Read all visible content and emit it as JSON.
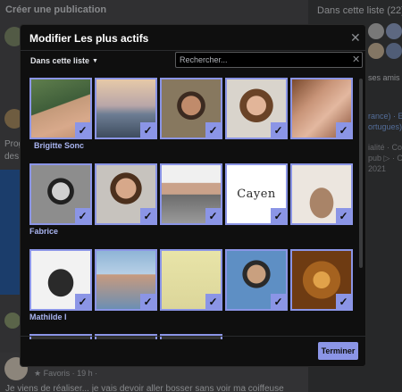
{
  "background": {
    "create_post_label": "Créer une publication",
    "list_header": "Dans cette liste (22)",
    "snippet_friends": "ses amis à c",
    "snippet_lang_1": "rance) · En",
    "snippet_lang_2": "ortugues) E",
    "snippet_policies": "ialité · Cond",
    "snippet_ads": "pub ▷ · Cookie",
    "snippet_year": "2021",
    "snippet_post_1": "Prog",
    "snippet_post_2": "des",
    "favorites_meta": "★ Favoris · 19 h ·",
    "post_text": "Je viens de réaliser... je vais devoir aller bosser sans voir ma coiffeuse"
  },
  "modal": {
    "title": "Modifier Les plus actifs",
    "close_icon": "close-icon",
    "filter_label": "Dans cette liste",
    "search_placeholder": "Rechercher...",
    "done_label": "Terminer",
    "accent_color": "#8b95e6",
    "tiles": [
      {
        "name": "Brigitte Sonc",
        "selected": true
      },
      {
        "name": "",
        "selected": true
      },
      {
        "name": "",
        "selected": true
      },
      {
        "name": "",
        "selected": true
      },
      {
        "name": "",
        "selected": true
      },
      {
        "name": "Fabrice",
        "selected": true
      },
      {
        "name": "",
        "selected": true
      },
      {
        "name": "",
        "selected": true
      },
      {
        "name": "Cayen",
        "selected": true
      },
      {
        "name": "",
        "selected": true
      },
      {
        "name": "Mathilde I",
        "selected": true
      },
      {
        "name": "",
        "selected": true
      },
      {
        "name": "",
        "selected": true
      },
      {
        "name": "",
        "selected": true
      },
      {
        "name": "",
        "selected": true
      }
    ]
  }
}
